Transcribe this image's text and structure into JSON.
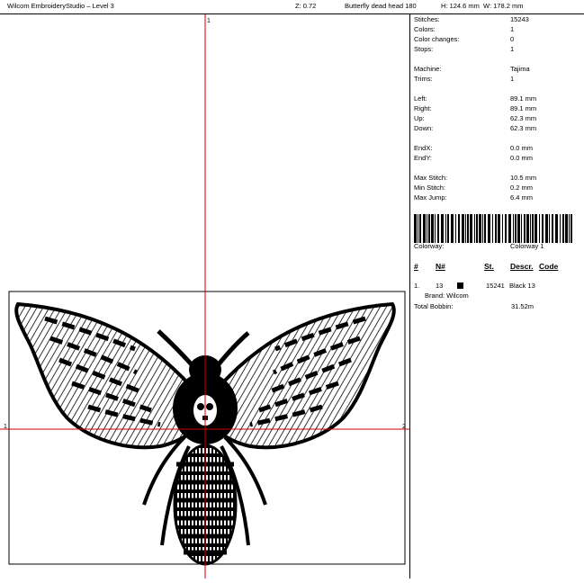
{
  "title_bar": {
    "app_title": "Wilcom EmbroideryStudio – Level 3",
    "zoom": "Z: 0.72",
    "design_name": "Butterfly dead head 180",
    "height": "H: 124.6 mm",
    "width": "W: 178.2 mm"
  },
  "canvas": {
    "marker_top": "1",
    "marker_left": "1",
    "marker_right": "2",
    "guide_color": "#cc0000"
  },
  "stats": [
    {
      "label": "Stitches:",
      "value": "15243"
    },
    {
      "label": "Colors:",
      "value": "1"
    },
    {
      "label": "Color changes:",
      "value": "0"
    },
    {
      "label": "Stops:",
      "value": "1"
    },
    {
      "label": "Machine:",
      "value": "Tajima"
    },
    {
      "label": "Trims:",
      "value": "1"
    },
    {
      "label": "Left:",
      "value": "89.1 mm"
    },
    {
      "label": "Right:",
      "value": "89.1 mm"
    },
    {
      "label": "Up:",
      "value": "62.3 mm"
    },
    {
      "label": "Down:",
      "value": "62.3 mm"
    },
    {
      "label": "EndX:",
      "value": "0.0 mm"
    },
    {
      "label": "EndY:",
      "value": "0.0 mm"
    },
    {
      "label": "Max Stitch:",
      "value": "10.5 mm"
    },
    {
      "label": "Min Stitch:",
      "value": "0.2 mm"
    },
    {
      "label": "Max Jump:",
      "value": "6.4 mm"
    }
  ],
  "colorway": {
    "label": "Colorway:",
    "value": "Colorway 1"
  },
  "color_table": {
    "headers": [
      "#",
      "N#",
      "St.",
      "Descr.",
      "Code"
    ],
    "rows": [
      {
        "index": "1.",
        "n": "13",
        "swatch": "#000000",
        "stitches": "15241",
        "descr": "Black 13",
        "brand": "Brand: Wilcom"
      }
    ]
  },
  "bobbin": {
    "label": "Total Bobbin:",
    "value": "31.52m"
  }
}
